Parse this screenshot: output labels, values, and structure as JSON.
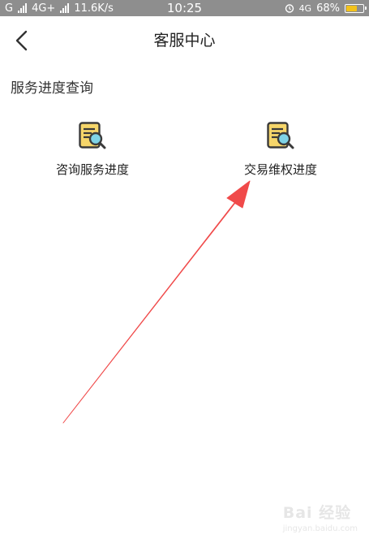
{
  "status_bar": {
    "carrier1": "G",
    "carrier2": "4G+",
    "speed": "11.6K/s",
    "time": "10:25",
    "network_right": "4G",
    "battery_percent": "68%",
    "battery_level": 0.68,
    "battery_color": "#f3c21b"
  },
  "header": {
    "title": "客服中心",
    "back_icon": "chevron-left-icon"
  },
  "section": {
    "title": "服务进度查询"
  },
  "entries": [
    {
      "label": "咨询服务进度",
      "icon": "document-search-icon"
    },
    {
      "label": "交易维权进度",
      "icon": "document-search-icon"
    }
  ],
  "annotation": {
    "arrow_color": "#f04a4a"
  },
  "watermark": {
    "text": "Bai 经验",
    "sub": "jingyan.baidu.com"
  }
}
